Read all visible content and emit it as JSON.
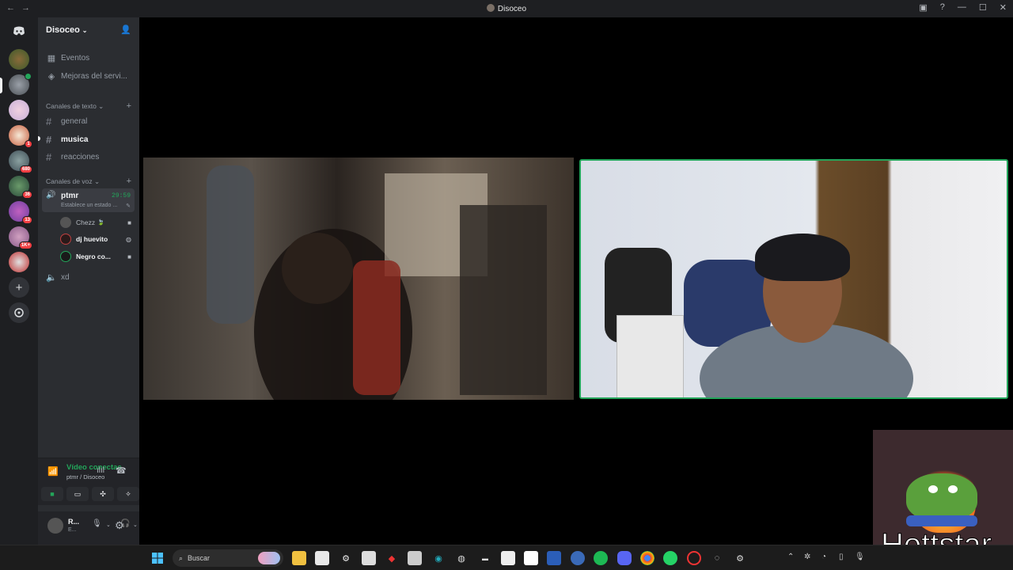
{
  "window": {
    "title": "Disoceo",
    "back": "←",
    "forward": "→",
    "controls": [
      "▣",
      "?",
      "—",
      "☐",
      "✕"
    ]
  },
  "guilds": [
    {
      "badge": ""
    },
    {
      "badge": ""
    },
    {
      "badge": ""
    },
    {
      "badge": "1"
    },
    {
      "badge": "680"
    },
    {
      "badge": "36"
    },
    {
      "badge": "13"
    },
    {
      "badge": "1K+"
    },
    {
      "badge": ""
    }
  ],
  "server": {
    "name": "Disoceo"
  },
  "channels": {
    "events": "Eventos",
    "boosts": "Mejoras del servi...",
    "text_category": "Canales de texto",
    "text": [
      "general",
      "musica",
      "reacciones"
    ],
    "voice_category": "Canales de voz",
    "voice_channel": "ptmr",
    "voice_timer": "29:59",
    "voice_status": "Establece un estado ...",
    "voice_users": [
      "Chezz",
      "dj huevito",
      "Negro co..."
    ],
    "voice_channel2": "xd"
  },
  "voice_panel": {
    "status": "Vídeo conectac",
    "sub": "ptmr / Disoceo"
  },
  "user_panel": {
    "name": "R...",
    "status": "E..."
  },
  "sticker": {
    "text": "Hottstar"
  },
  "taskbar": {
    "search_placeholder": "Buscar"
  },
  "colors": {
    "accent_green": "#23a55a",
    "background": "#000000",
    "sidebar": "#2b2d31"
  }
}
